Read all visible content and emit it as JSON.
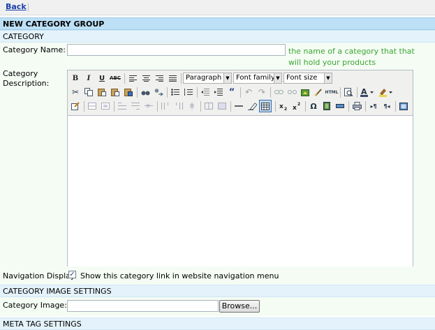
{
  "topbar": {
    "back_label": "Back"
  },
  "group_header": "NEW CATEGORY GROUP",
  "category_section": {
    "header": "CATEGORY",
    "name_label": "Category Name:",
    "name_value": "",
    "name_hint": "the name of a category that that will hold your products",
    "description_label_line1": "Category",
    "description_label_line2": "Description:"
  },
  "editor": {
    "paragraph_select": "Paragraph",
    "font_family_select": "Font family",
    "font_size_select": "Font size",
    "bold_label": "B",
    "italic_label": "I",
    "underline_label": "U",
    "strike_label": "ABC",
    "html_label": "HTML",
    "content": ""
  },
  "navigation": {
    "label": "Navigation Display:",
    "checked": true,
    "checkbox_label": "Show this category link in website navigation menu"
  },
  "image_section": {
    "header": "CATEGORY IMAGE SETTINGS",
    "image_label": "Category Image:",
    "browse_label": "Browse..."
  },
  "meta_section": {
    "header": "META TAG SETTINGS"
  },
  "colors": {
    "hint": "#3aa632",
    "header_bg": "#bde0f6",
    "section_bg": "#e4f3fb",
    "pane_bg": "#f5fcf4",
    "link": "#1a3ea8"
  }
}
